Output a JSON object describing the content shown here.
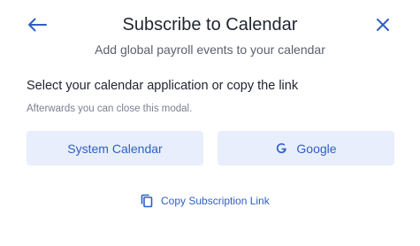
{
  "header": {
    "title": "Subscribe to Calendar",
    "subtitle": "Add global payroll events to your calendar",
    "back_icon": "arrow-left-icon",
    "close_icon": "close-icon"
  },
  "body": {
    "instruction": "Select your calendar application or copy the link",
    "hint": "Afterwards you can close this modal."
  },
  "options": {
    "system_calendar_label": "System Calendar",
    "google_label": "Google",
    "google_icon": "google-g-icon"
  },
  "copy_link": {
    "label": "Copy Subscription Link",
    "icon": "copy-icon"
  },
  "colors": {
    "accent": "#2f5fc4",
    "button_bg": "#e8eefb",
    "title_text": "#1f2430",
    "muted_text": "#5b6070",
    "hint_text": "#7b8090"
  }
}
